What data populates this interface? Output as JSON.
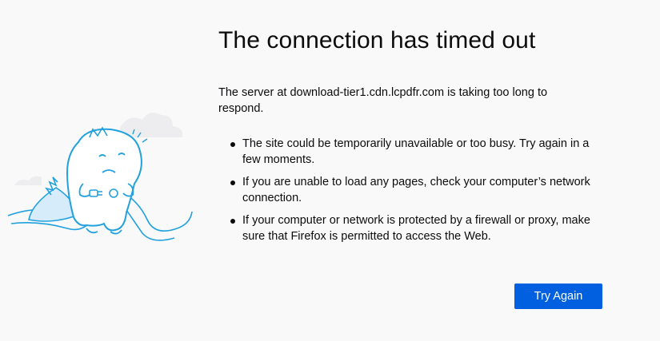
{
  "error": {
    "title": "The connection has timed out",
    "description": "The server at download-tier1.cdn.lcpdfr.com is taking too long to respond.",
    "reasons": [
      "The site could be temporarily unavailable or too busy. Try again in a few moments.",
      "If you are unable to load any pages, check your computer’s network connection.",
      "If your computer or network is protected by a firewall or proxy, make sure that Firefox is permitted to access the Web."
    ],
    "try_again_label": "Try Again"
  },
  "illustration": {
    "icon": "dino-unplugged-cable-illustration"
  },
  "colors": {
    "background": "#f9f9fa",
    "button": "#0060df",
    "button_text": "#ffffff",
    "text": "#0c0c0d",
    "illustration_stroke": "#23a1dd"
  }
}
